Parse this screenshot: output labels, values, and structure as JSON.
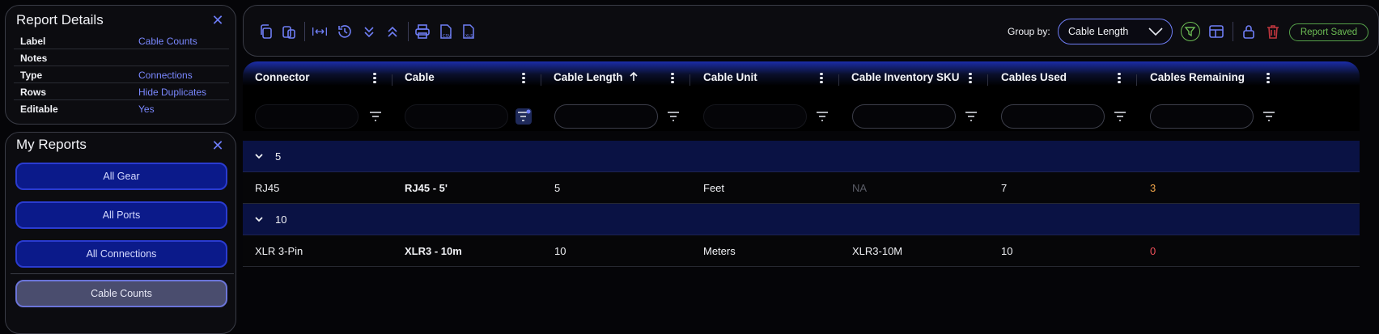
{
  "report_details": {
    "title": "Report Details",
    "rows": [
      {
        "key": "Label",
        "value": "Cable Counts"
      },
      {
        "key": "Notes",
        "value": ""
      },
      {
        "key": "Type",
        "value": "Connections"
      },
      {
        "key": "Rows",
        "value": "Hide Duplicates"
      },
      {
        "key": "Editable",
        "value": "Yes"
      }
    ]
  },
  "my_reports": {
    "title": "My Reports",
    "items": [
      {
        "label": "All Gear",
        "active": false
      },
      {
        "label": "All Ports",
        "active": false
      },
      {
        "label": "All Connections",
        "active": false
      },
      {
        "label": "Cable Counts",
        "active": true
      }
    ]
  },
  "toolbar": {
    "group_by_label": "Group by:",
    "group_by_value": "Cable Length",
    "status_badge": "Report Saved",
    "icons": [
      "copy-icon",
      "paste-icon",
      "fit-columns-icon",
      "history-icon",
      "expand-all-icon",
      "collapse-all-icon",
      "print-icon",
      "export-csv-icon",
      "export-xls-icon",
      "toggle-icon",
      "layout-icon",
      "lock-icon",
      "trash-icon"
    ]
  },
  "grid": {
    "columns": [
      {
        "label": "Connector"
      },
      {
        "label": "Cable"
      },
      {
        "label": "Cable Length",
        "sort": "asc"
      },
      {
        "label": "Cable Unit"
      },
      {
        "label": "Cable Inventory SKU"
      },
      {
        "label": "Cables Used"
      },
      {
        "label": "Cables Remaining"
      }
    ],
    "groups": [
      {
        "label": "5",
        "rows": [
          {
            "connector": "RJ45",
            "cable": "RJ45 - 5'",
            "length": "5",
            "unit": "Feet",
            "sku": "NA",
            "used": "7",
            "remaining": "3"
          }
        ]
      },
      {
        "label": "10",
        "rows": [
          {
            "connector": "XLR 3-Pin",
            "cable": "XLR3 - 10m",
            "length": "10",
            "unit": "Meters",
            "sku": "XLR3-10M",
            "used": "10",
            "remaining": "0"
          }
        ]
      }
    ]
  },
  "colors": {
    "accent": "#6f7ef5",
    "button_blue": "#0b1a8a",
    "group_row": "#0a1244",
    "success": "#6dbd55",
    "warning": "#f0a54a",
    "danger": "#f0505a"
  }
}
